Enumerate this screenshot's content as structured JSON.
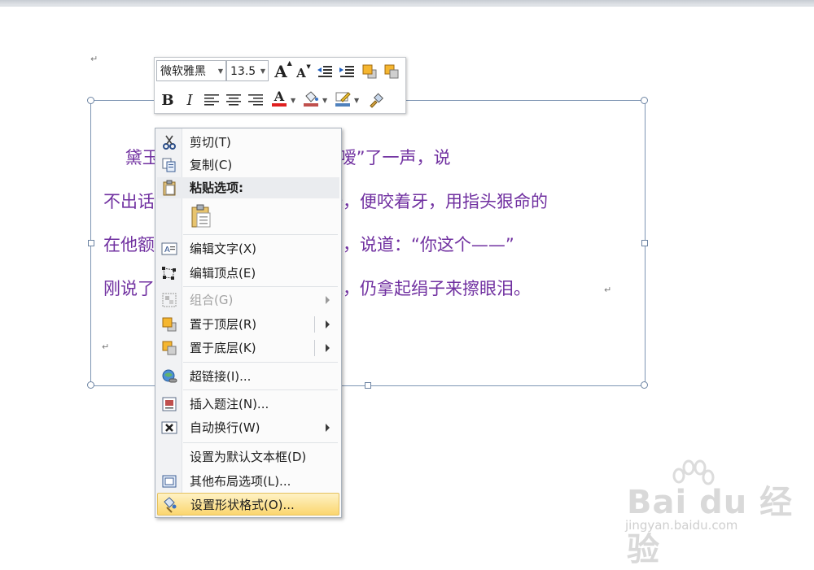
{
  "document": {
    "para_mark": "↵",
    "textbox_lines": [
      "    黛玉只是瞅了他半天，气的“嗳”了一声，说",
      "不出话来。见宝玉憋的脸上紫涨，便咬着牙，用指头狠命的",
      "在他额颅上戳了一下，哼了一声，说道：“你这个——”",
      "刚说了两个字，便又叹了一口气，仍拿起绢子来擦眼泪。"
    ],
    "text_color": "#7030a0"
  },
  "mini_toolbar": {
    "font_name": "微软雅黑",
    "font_size": "13.5",
    "buttons": {
      "grow_font": "A",
      "shrink_font": "A",
      "bold": "B",
      "italic": "I",
      "font_color": "A"
    },
    "font_color_swatch": "#e02020",
    "fill_color_swatch": "#c0504d",
    "line_color_swatch": "#4f81bd"
  },
  "context_menu": {
    "items": [
      {
        "label": "剪切(T)",
        "icon": "scissors-icon"
      },
      {
        "label": "复制(C)",
        "icon": "copy-icon"
      },
      {
        "label": "粘贴选项:",
        "icon": "paste-icon"
      },
      {
        "label": "编辑文字(X)",
        "icon": "edit-text-icon"
      },
      {
        "label": "编辑顶点(E)",
        "icon": "edit-points-icon"
      },
      {
        "label": "组合(G)",
        "icon": "group-icon",
        "disabled": true
      },
      {
        "label": "置于顶层(R)",
        "icon": "bring-to-front-icon"
      },
      {
        "label": "置于底层(K)",
        "icon": "send-to-back-icon"
      },
      {
        "label": "超链接(I)...",
        "icon": "hyperlink-icon"
      },
      {
        "label": "插入题注(N)...",
        "icon": "insert-caption-icon"
      },
      {
        "label": "自动换行(W)",
        "icon": "text-wrap-icon"
      },
      {
        "label": "设置为默认文本框(D)",
        "icon": ""
      },
      {
        "label": "其他布局选项(L)...",
        "icon": "layout-options-icon"
      },
      {
        "label": "设置形状格式(O)...",
        "icon": "format-shape-icon"
      }
    ]
  },
  "watermark": {
    "logo": "Bai du 经验",
    "url": "jingyan.baidu.com"
  }
}
